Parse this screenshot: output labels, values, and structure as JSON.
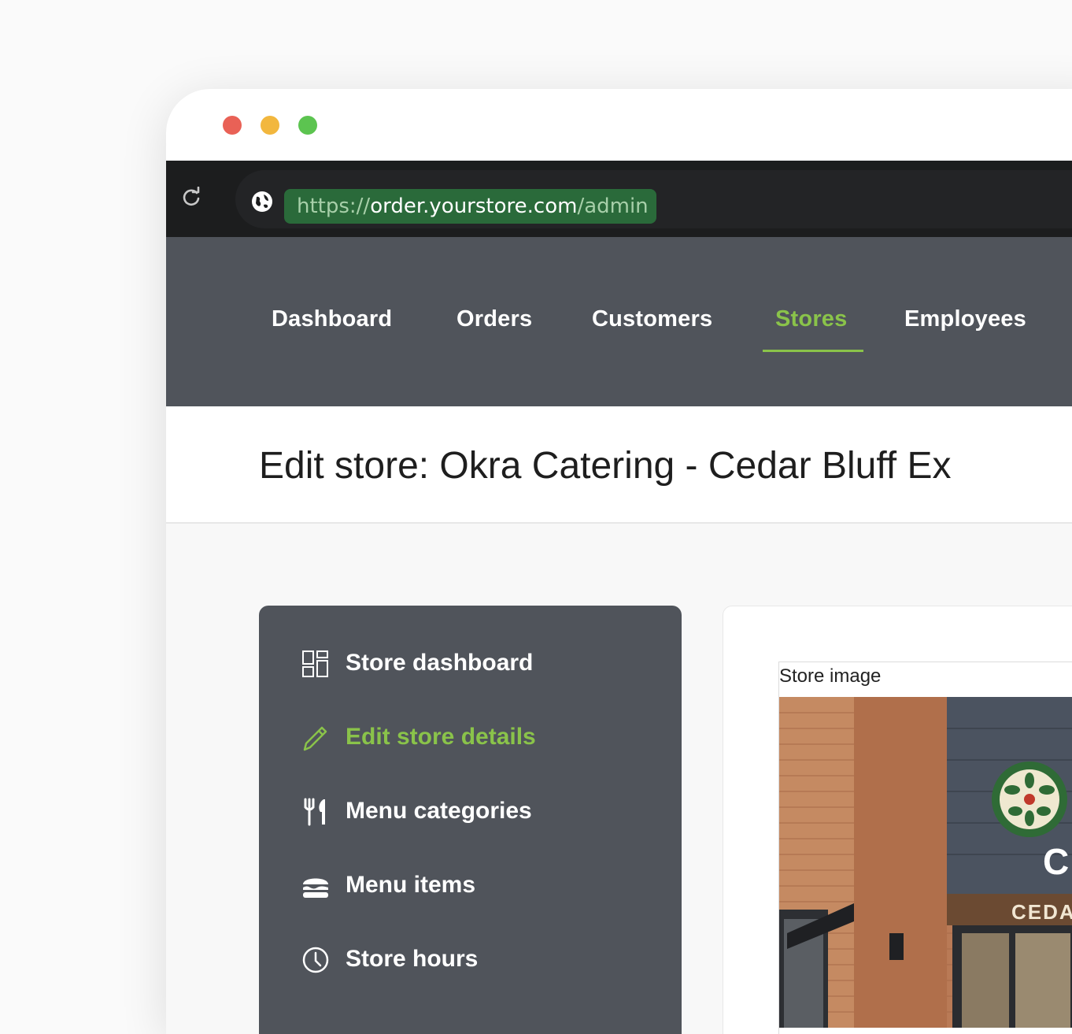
{
  "window": {
    "controls": [
      "close",
      "minimize",
      "maximize"
    ]
  },
  "browser": {
    "reload_icon": "reload-icon",
    "globe_icon": "globe-icon",
    "url_scheme": "https://",
    "url_host": "order.yourstore.com",
    "url_path": "/admin"
  },
  "nav": {
    "items": [
      {
        "label": "Dashboard",
        "active": false
      },
      {
        "label": "Orders",
        "active": false
      },
      {
        "label": "Customers",
        "active": false
      },
      {
        "label": "Stores",
        "active": true
      },
      {
        "label": "Employees",
        "active": false
      }
    ],
    "accent_color": "#8ac34a"
  },
  "page": {
    "title": "Edit store: Okra Catering - Cedar Bluff Ex"
  },
  "sidebar": {
    "items": [
      {
        "label": "Store dashboard",
        "icon": "grid-icon",
        "active": false
      },
      {
        "label": "Edit store details",
        "icon": "pencil-icon",
        "active": true
      },
      {
        "label": "Menu categories",
        "icon": "utensils-icon",
        "active": false
      },
      {
        "label": "Menu items",
        "icon": "burger-icon",
        "active": false
      },
      {
        "label": "Store hours",
        "icon": "clock-icon",
        "active": false
      }
    ]
  },
  "store_image": {
    "label": "Store image",
    "sign_letter": "C",
    "sign_text": "CEDA"
  },
  "colors": {
    "nav_background": "#50545b",
    "browser_bar": "#1c1d1e",
    "url_highlight": "#2a6a3a"
  }
}
